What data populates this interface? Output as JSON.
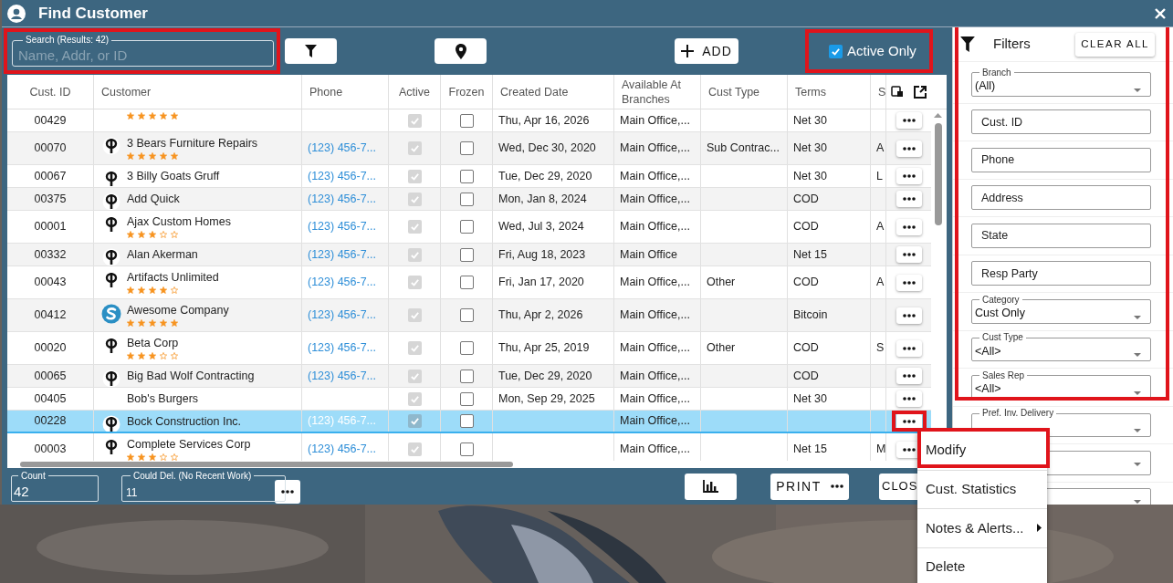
{
  "window": {
    "title": "Find Customer"
  },
  "toolbar": {
    "search": {
      "label": "Search (Results: 42)",
      "placeholder": "Name, Addr, or ID",
      "highlighted": true
    },
    "add_label": "ADD",
    "active_only": {
      "label": "Active Only",
      "checked": true,
      "highlighted": true
    }
  },
  "table": {
    "columns": [
      "Cust. ID",
      "Customer",
      "Phone",
      "Active",
      "Frozen",
      "Created Date",
      "Available At Branches",
      "Cust Type",
      "Terms",
      "S"
    ],
    "rows": [
      {
        "id": "00429",
        "stars": 5,
        "active": true,
        "frozen": false,
        "created": "Thu, Apr 16, 2026",
        "branches": "Main Office,...",
        "terms": "Net 30",
        "selected": false,
        "menu_highlighted": false
      },
      {
        "id": "00070",
        "kind": "p_logo",
        "name": "3 Bears Furniture Repairs",
        "stars": 5,
        "phone": "(123) 456-7...",
        "active": true,
        "frozen": false,
        "created": "Wed, Dec 30, 2020",
        "branches": "Main Office,...",
        "cust_type": "Sub Contrac...",
        "terms": "Net 30",
        "s": "A",
        "selected": false,
        "menu_highlighted": false
      },
      {
        "id": "00067",
        "kind": "p_logo",
        "name": "3 Billy Goats Gruff",
        "phone": "(123) 456-7...",
        "active": true,
        "frozen": false,
        "created": "Tue, Dec 29, 2020",
        "branches": "Main Office,...",
        "terms": "Net 30",
        "s": "L",
        "selected": false,
        "menu_highlighted": false
      },
      {
        "id": "00375",
        "kind": "p_logo",
        "name": "Add Quick",
        "phone": "(123) 456-7...",
        "active": true,
        "frozen": false,
        "created": "Mon, Jan 8, 2024",
        "branches": "Main Office,...",
        "terms": "COD",
        "selected": false,
        "menu_highlighted": false
      },
      {
        "id": "00001",
        "kind": "p_logo",
        "name": "Ajax Custom Homes",
        "stars": 3,
        "phone": "(123) 456-7...",
        "active": true,
        "frozen": false,
        "created": "Wed, Jul 3, 2024",
        "branches": "Main Office,...",
        "terms": "COD",
        "s": "A",
        "selected": false,
        "menu_highlighted": false
      },
      {
        "id": "00332",
        "kind": "p_logo",
        "name": "Alan Akerman",
        "phone": "(123) 456-7...",
        "active": true,
        "frozen": false,
        "created": "Fri, Aug 18, 2023",
        "branches": "Main Office",
        "terms": "Net 15",
        "selected": false,
        "menu_highlighted": false
      },
      {
        "id": "00043",
        "kind": "p_logo",
        "name": "Artifacts Unlimited",
        "stars": 4,
        "phone": "(123) 456-7...",
        "active": true,
        "frozen": false,
        "created": "Fri, Jan 17, 2020",
        "branches": "Main Office,...",
        "cust_type": "Other",
        "terms": "COD",
        "s": "A",
        "selected": false,
        "menu_highlighted": false
      },
      {
        "id": "00412",
        "kind": "s_logo",
        "name": "Awesome Company",
        "stars": 5,
        "phone": "(123) 456-7...",
        "active": true,
        "frozen": false,
        "created": "Thu, Apr 2, 2026",
        "branches": "Main Office,...",
        "terms": "Bitcoin",
        "selected": false,
        "menu_highlighted": false
      },
      {
        "id": "00020",
        "kind": "p_logo",
        "name": "Beta Corp",
        "stars": 3,
        "phone": "(123) 456-7...",
        "active": true,
        "frozen": false,
        "created": "Thu, Apr 25, 2019",
        "branches": "Main Office,...",
        "cust_type": "Other",
        "terms": "COD",
        "s": "S",
        "selected": false,
        "menu_highlighted": false
      },
      {
        "id": "00065",
        "kind": "p_logo",
        "name": "Big Bad Wolf Contracting",
        "phone": "(123) 456-7...",
        "active": true,
        "frozen": false,
        "created": "Tue, Dec 29, 2020",
        "branches": "Main Office,...",
        "terms": "COD",
        "selected": false,
        "menu_highlighted": false
      },
      {
        "id": "00405",
        "name": "Bob's Burgers",
        "active": true,
        "frozen": false,
        "created": "Mon, Sep 29, 2025",
        "branches": "Main Office,...",
        "terms": "Net 30",
        "selected": false,
        "menu_highlighted": false
      },
      {
        "id": "00228",
        "kind": "p_logo",
        "name": "Bock Construction Inc.",
        "phone": "(123) 456-7...",
        "active": true,
        "frozen": false,
        "branches": "Main Office,...",
        "selected": true,
        "menu_highlighted": true
      },
      {
        "id": "00003",
        "kind": "p_logo",
        "name": "Complete Services Corp",
        "stars": 3,
        "phone": "(123) 456-7...",
        "active": true,
        "frozen": false,
        "branches": "Main Office,...",
        "terms": "Net 15",
        "s": "M",
        "selected": false,
        "menu_highlighted": false
      }
    ]
  },
  "bottom_bar": {
    "count": {
      "label": "Count",
      "value": "42"
    },
    "could_delete": {
      "label": "Could Del. (No Recent Work)",
      "value": "11"
    },
    "print_label": "PRINT",
    "close_label": "CLOS"
  },
  "filters": {
    "title": "Filters",
    "clear_label": "CLEAR ALL",
    "highlighted": true,
    "fields": [
      {
        "kind": "select",
        "label": "Branch",
        "value": "(All)"
      },
      {
        "kind": "text",
        "placeholder": "Cust. ID"
      },
      {
        "kind": "text",
        "placeholder": "Phone"
      },
      {
        "kind": "text",
        "placeholder": "Address"
      },
      {
        "kind": "text",
        "placeholder": "State"
      },
      {
        "kind": "text",
        "placeholder": "Resp Party"
      },
      {
        "kind": "select",
        "label": "Category",
        "value": "Cust Only"
      },
      {
        "kind": "select",
        "label": "Cust Type",
        "value": "<All>"
      },
      {
        "kind": "select",
        "label": "Sales Rep",
        "value": "<All>"
      },
      {
        "kind": "select",
        "label": "Pref. Inv. Delivery"
      },
      {
        "kind": "select"
      },
      {
        "kind": "select"
      }
    ]
  },
  "context_menu": {
    "items": [
      {
        "label": "Modify",
        "highlighted": true,
        "submenu": false
      },
      {
        "label": "Cust. Statistics",
        "highlighted": false,
        "submenu": false
      },
      {
        "label": "Notes & Alerts...",
        "highlighted": false,
        "submenu": true
      },
      {
        "label": "Delete",
        "highlighted": false,
        "submenu": false
      }
    ]
  }
}
